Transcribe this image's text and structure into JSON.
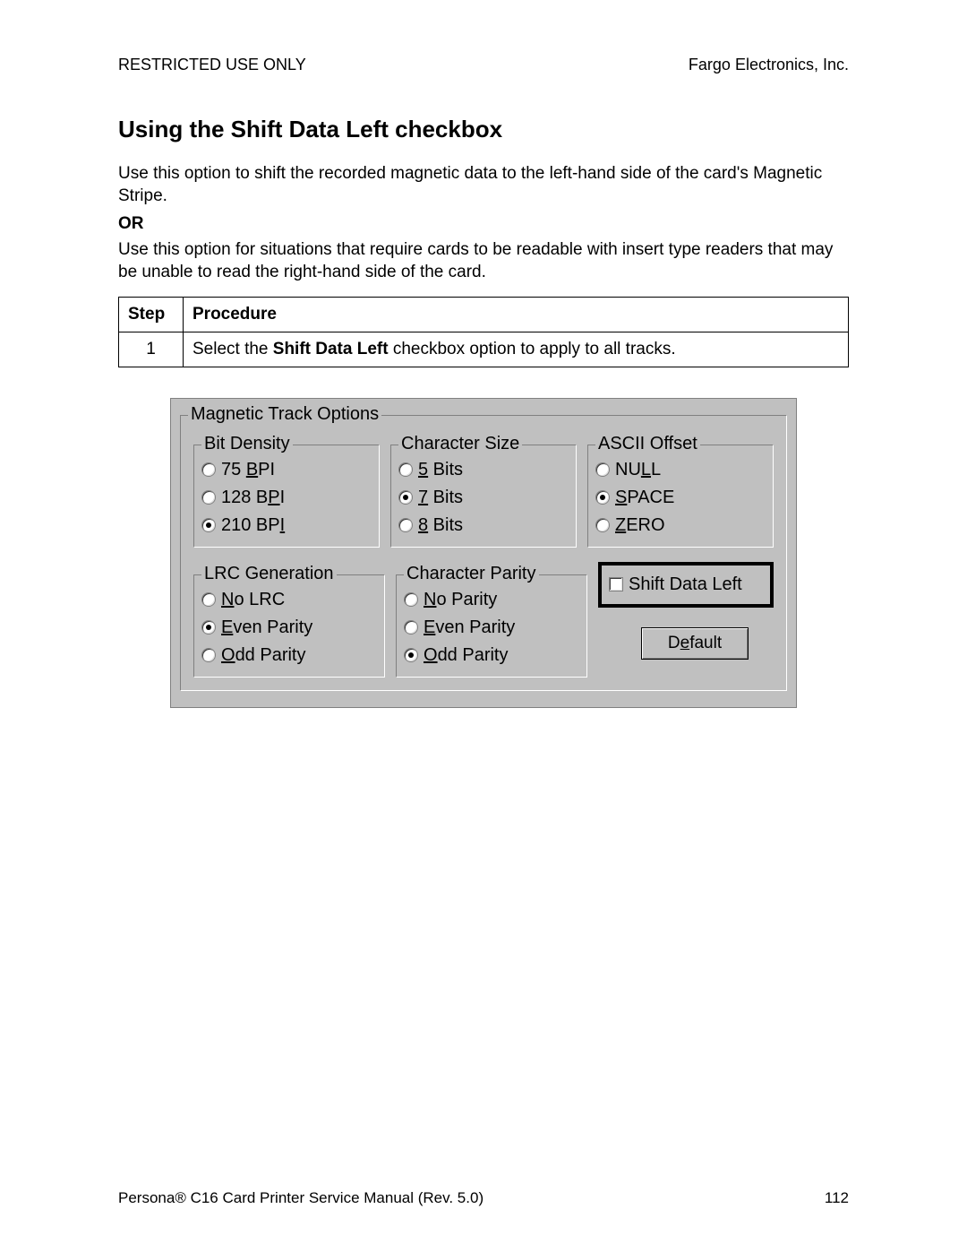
{
  "header": {
    "left": "RESTRICTED USE ONLY",
    "right": "Fargo Electronics, Inc."
  },
  "title": "Using the Shift Data Left checkbox",
  "para1": "Use this option to shift the recorded magnetic data to the left-hand side of the card's Magnetic Stripe.",
  "or": "OR",
  "para2": "Use this option for situations that require cards to be readable with insert type readers that may be unable to read the right-hand side of the card.",
  "table": {
    "head": {
      "step": "Step",
      "proc": "Procedure"
    },
    "row": {
      "step": "1",
      "pre": "Select the ",
      "bold": "Shift Data Left",
      "post": " checkbox option to apply to all tracks."
    }
  },
  "dlg": {
    "outer": "Magnetic Track Options",
    "bitdensity": {
      "label": "Bit Density",
      "o1": {
        "p1": "  75 ",
        "u": "B",
        "p2": "PI"
      },
      "o2": {
        "p1": "128 B",
        "u": "P",
        "p2": "I"
      },
      "o3": {
        "p1": "210 BP",
        "u": "I",
        "p2": ""
      }
    },
    "charsize": {
      "label": "Character Size",
      "o1": {
        "u": "5",
        "p": " Bits"
      },
      "o2": {
        "u": "7",
        "p": " Bits"
      },
      "o3": {
        "u": "8",
        "p": " Bits"
      }
    },
    "ascii": {
      "label": "ASCII Offset",
      "o1": {
        "p1": "NU",
        "u": "L",
        "p2": "L"
      },
      "o2": {
        "u": "S",
        "p": "PACE"
      },
      "o3": {
        "u": "Z",
        "p": "ERO"
      }
    },
    "lrc": {
      "label": "LRC Generation",
      "o1": {
        "u": "N",
        "p": "o LRC"
      },
      "o2": {
        "u": "E",
        "p": "ven Parity"
      },
      "o3": {
        "u": "O",
        "p": "dd Parity"
      }
    },
    "charparity": {
      "label": "Character Parity",
      "o1": {
        "u": "N",
        "p": "o Parity"
      },
      "o2": {
        "u": "E",
        "p": "ven Parity"
      },
      "o3": {
        "u": "O",
        "p": "dd Parity"
      }
    },
    "shift": "Shift Data Left",
    "default": {
      "p1": "D",
      "u": "e",
      "p2": "fault"
    }
  },
  "footer": {
    "left": "Persona® C16 Card Printer Service Manual (Rev. 5.0)",
    "right": "112"
  }
}
